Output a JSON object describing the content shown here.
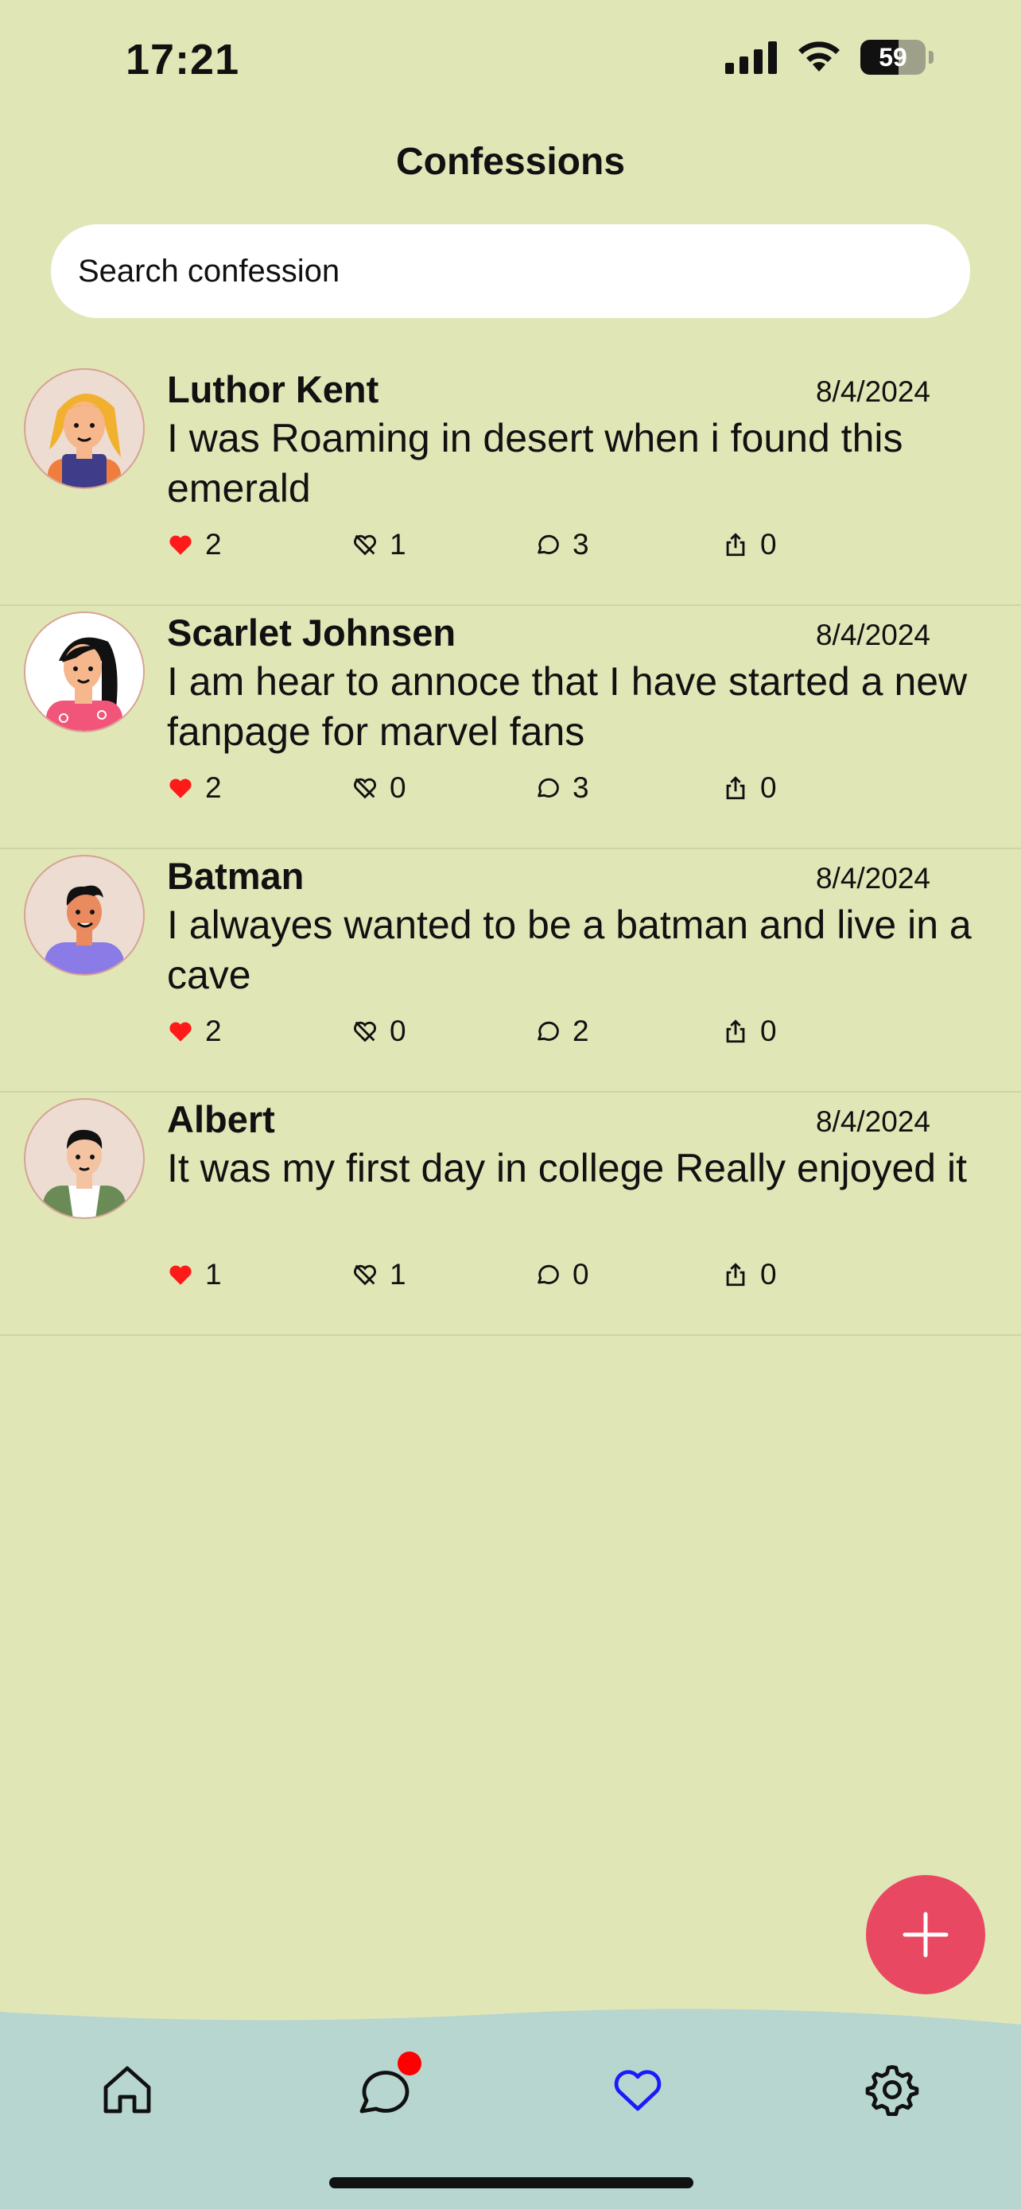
{
  "status_bar": {
    "time": "17:21",
    "battery": "59",
    "battery_level": 0.59
  },
  "header": {
    "title": "Confessions"
  },
  "search": {
    "placeholder": "Search confession"
  },
  "posts": [
    {
      "author": "Luthor Kent",
      "date": "8/4/2024",
      "message": "I was Roaming in desert when i found this emerald",
      "likes": "2",
      "dislikes": "1",
      "comments": "3",
      "shares": "0",
      "avatar_icon": "woman-yellow-hair-avatar"
    },
    {
      "author": "Scarlet Johnsen",
      "date": "8/4/2024",
      "message": "I am hear to annoce that I have started a new fanpage for marvel fans",
      "likes": "2",
      "dislikes": "0",
      "comments": "3",
      "shares": "0",
      "avatar_icon": "woman-black-hair-avatar"
    },
    {
      "author": "Batman",
      "date": "8/4/2024",
      "message": "I alwayes wanted to be a batman and live in a cave",
      "likes": "2",
      "dislikes": "0",
      "comments": "2",
      "shares": "0",
      "avatar_icon": "man-purple-shirt-avatar"
    },
    {
      "author": "Albert",
      "date": "8/4/2024",
      "message": "It was my first day in college Really enjoyed it",
      "likes": "1",
      "dislikes": "1",
      "comments": "0",
      "shares": "0",
      "avatar_icon": "man-green-jacket-avatar"
    }
  ],
  "tab_bar": {
    "tabs": [
      "home",
      "chat",
      "favorites",
      "settings"
    ],
    "active": "favorites",
    "chat_has_notification": true
  },
  "colors": {
    "background": "#e1e6b7",
    "tab_bar": "#b6d6cf",
    "fab": "#e84862",
    "like": "#ff1a1a",
    "active_tab": "#1a1aff",
    "badge": "#ff0000"
  }
}
